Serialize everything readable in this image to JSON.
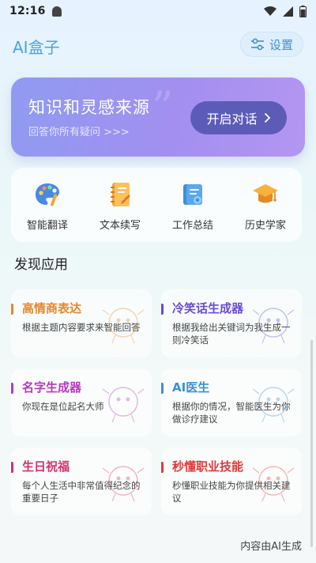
{
  "status": {
    "time": "12:16"
  },
  "header": {
    "app_title": "AI盒子",
    "settings_label": "设置"
  },
  "banner": {
    "title": "知识和灵感来源",
    "subtitle": "回答你所有疑问 >>>",
    "button_label": "开启对话",
    "quote_mark": "”"
  },
  "tools": [
    {
      "label": "智能翻译",
      "icon": "palette-icon"
    },
    {
      "label": "文本续写",
      "icon": "notebook-icon"
    },
    {
      "label": "工作总结",
      "icon": "scroll-icon"
    },
    {
      "label": "历史学家",
      "icon": "graduation-cap-icon"
    }
  ],
  "section": {
    "title": "发现应用"
  },
  "apps": [
    {
      "name": "高情商表达",
      "desc": "根据主题内容要求来智能回答",
      "color": "#e6862b"
    },
    {
      "name": "冷笑话生成器",
      "desc": "根据我给出关键词为我生成一则冷笑话",
      "color": "#6a4cd6"
    },
    {
      "name": "名字生成器",
      "desc": "你现在是位起名大师",
      "color": "#b43bbf"
    },
    {
      "name": "AI医生",
      "desc": "根据你的情况，智能医生为你做诊疗建议",
      "color": "#3b8fd8"
    },
    {
      "name": "生日祝福",
      "desc": "每个人生活中非常值得纪念的重要日子",
      "color": "#d8306e"
    },
    {
      "name": "秒懂职业技能",
      "desc": "秒懂职业技能为你提供相关建议",
      "color": "#e23a3a"
    }
  ],
  "footer": {
    "note": "内容由AI生成"
  },
  "colors": {
    "accent": "#4aa3e6",
    "banner_button": "#5d5bb8"
  }
}
